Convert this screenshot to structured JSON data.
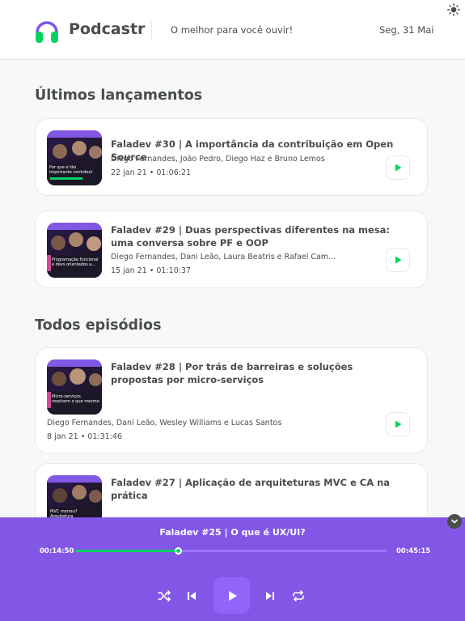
{
  "header": {
    "brand": "Podcastr",
    "tagline": "O melhor para você ouvir!",
    "date": "Seg, 31 Mai"
  },
  "colors": {
    "brand_purple": "#8257e5",
    "accent_green": "#04d361",
    "text": "#494d4b"
  },
  "latest": {
    "title": "Últimos lançamentos",
    "episodes": [
      {
        "title": "Faladev #30 | A importância da contribuição em Open Source",
        "members": "Diego Fernandes, João Pedro, Diego Haz e Bruno Lemos",
        "published": "22 jan 21",
        "duration": "01:06:21",
        "thumb_text": "Por que é tão importante contribuir em Open Source"
      },
      {
        "title": "Faladev #29 | Duas perspectivas diferentes na mesa: uma conversa sobre PF e OOP",
        "members": "Diego Fernandes, Dani Leão, Laura Beatris e Rafael Cam...",
        "published": "15 jan 21",
        "duration": "01:10:37",
        "thumb_text": "Programação funcional e devs orientados a..."
      }
    ]
  },
  "all": {
    "title": "Todos episódios",
    "episodes": [
      {
        "title": "Faladev #28 | Por trás de barreiras e soluções propostas por micro-serviços",
        "members": "Diego Fernandes, Dani Leão, Wesley Williams e Lucas Santos",
        "published": "8 jan 21",
        "duration": "01:31:46",
        "thumb_text": "Micro-serviços resolvem o que mesmo"
      },
      {
        "title": "Faladev #27 | Aplicação de arquiteturas MVC e CA na prática",
        "thumb_text": "MVC morreu? Arquitetura"
      }
    ]
  },
  "meta_separator": "•",
  "player": {
    "now_playing": "Faladev #25 | O que é UX/UI?",
    "current_time": "00:14:50",
    "total_time": "00:45:15",
    "progress": 0.328
  },
  "icons": {
    "logo": "headphones-icon",
    "theme": "sun-icon",
    "play": "play-icon",
    "shuffle": "shuffle-icon",
    "previous": "skip-previous-icon",
    "next": "skip-next-icon",
    "repeat": "repeat-icon",
    "collapse": "chevron-down-icon"
  }
}
